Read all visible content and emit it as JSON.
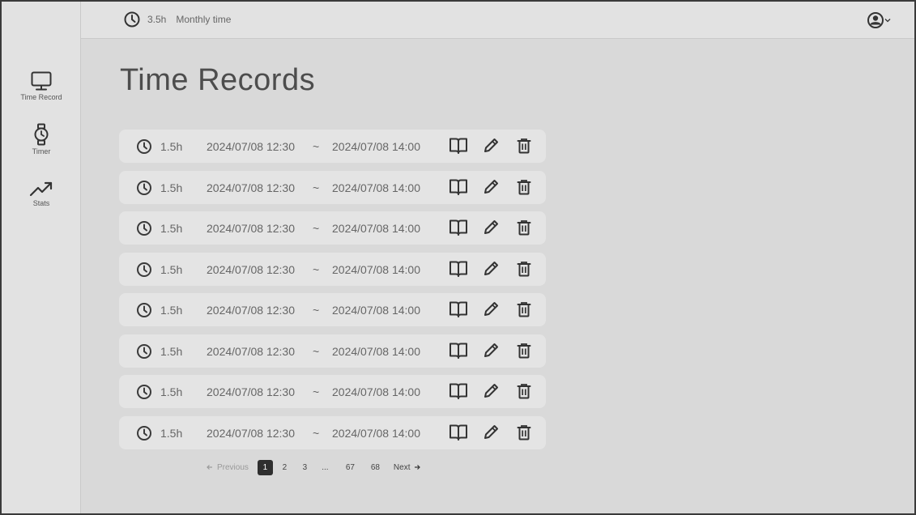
{
  "topbar": {
    "monthly_hours": "3.5h",
    "monthly_label": "Monthly time"
  },
  "sidebar": {
    "items": [
      {
        "label": "Time Record",
        "icon": "monitor-icon"
      },
      {
        "label": "Timer",
        "icon": "watch-icon"
      },
      {
        "label": "Stats",
        "icon": "trending-up-icon"
      }
    ]
  },
  "main": {
    "title": "Time Records",
    "records": [
      {
        "duration": "1.5h",
        "start": "2024/07/08 12:30",
        "sep": "~",
        "end": "2024/07/08 14:00"
      },
      {
        "duration": "1.5h",
        "start": "2024/07/08 12:30",
        "sep": "~",
        "end": "2024/07/08 14:00"
      },
      {
        "duration": "1.5h",
        "start": "2024/07/08 12:30",
        "sep": "~",
        "end": "2024/07/08 14:00"
      },
      {
        "duration": "1.5h",
        "start": "2024/07/08 12:30",
        "sep": "~",
        "end": "2024/07/08 14:00"
      },
      {
        "duration": "1.5h",
        "start": "2024/07/08 12:30",
        "sep": "~",
        "end": "2024/07/08 14:00"
      },
      {
        "duration": "1.5h",
        "start": "2024/07/08 12:30",
        "sep": "~",
        "end": "2024/07/08 14:00"
      },
      {
        "duration": "1.5h",
        "start": "2024/07/08 12:30",
        "sep": "~",
        "end": "2024/07/08 14:00"
      },
      {
        "duration": "1.5h",
        "start": "2024/07/08 12:30",
        "sep": "~",
        "end": "2024/07/08 14:00"
      }
    ]
  },
  "pagination": {
    "prev_label": "Previous",
    "next_label": "Next",
    "pages": [
      "1",
      "2",
      "3",
      "...",
      "67",
      "68"
    ],
    "current": "1"
  },
  "colors": {
    "background": "#d9d9d9",
    "panel": "#e2e2e2",
    "card": "#e4e4e4",
    "text": "#4a4a4a",
    "active_page": "#2f2f2f"
  }
}
